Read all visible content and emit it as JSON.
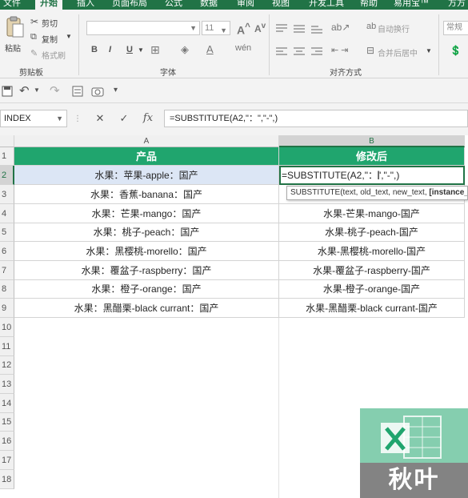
{
  "ribbon_tabs": [
    "文件",
    "开始",
    "插入",
    "页面布局",
    "公式",
    "数据",
    "审阅",
    "视图",
    "开发工具",
    "帮助",
    "易用宝™",
    "方方"
  ],
  "active_tab_index": 1,
  "clipboard": {
    "paste": "粘贴",
    "cut": "剪切",
    "copy": "复制",
    "format_painter": "格式刷",
    "group": "剪贴板"
  },
  "font_group": {
    "font_size": "11",
    "bold": "B",
    "italic": "I",
    "underline": "U",
    "group": "字体"
  },
  "alignment_group": {
    "wrap_text": "自动换行",
    "merge_center": "合并后居中",
    "group": "对齐方式"
  },
  "number_group": {
    "format": "常规"
  },
  "formula_bar": {
    "name_box": "INDEX",
    "cancel": "✕",
    "confirm": "✓",
    "fx": "fx",
    "formula": "=SUBSTITUTE(A2,\"：\",\"-\",)"
  },
  "columns": [
    "A",
    "B"
  ],
  "row_numbers": [
    "1",
    "2",
    "3",
    "4",
    "5",
    "6",
    "7",
    "8",
    "9",
    "10",
    "11",
    "12",
    "13",
    "14",
    "15",
    "16",
    "17",
    "18"
  ],
  "table": {
    "headers": [
      "产品",
      "修改后"
    ],
    "rows": [
      [
        "水果：苹果-apple：国产",
        "=SUBSTITUTE(A2,\"：\",\"-\",)"
      ],
      [
        "水果：香蕉-banana：国产",
        "水果-香蕉-banana-国产"
      ],
      [
        "水果：芒果-mango：国产",
        "水果-芒果-mango-国产"
      ],
      [
        "水果：桃子-peach：国产",
        "水果-桃子-peach-国产"
      ],
      [
        "水果：黑樱桃-morello：国产",
        "水果-黑樱桃-morello-国产"
      ],
      [
        "水果：覆盆子-raspberry：国产",
        "水果-覆盆子-raspberry-国产"
      ],
      [
        "水果：橙子-orange：国产",
        "水果-橙子-orange-国产"
      ],
      [
        "水果：黑醋栗-black currant：国产",
        "水果-黑醋栗-black currant-国产"
      ]
    ]
  },
  "tooltip": {
    "args": "SUBSTITUTE(text, old_text, new_text, ",
    "current_arg": "[instance_num]"
  },
  "watermark": {
    "text": "秋叶"
  },
  "colors": {
    "excel_green": "#217346",
    "header_fill": "#20a56e",
    "selection_fill": "#dce6f5"
  }
}
